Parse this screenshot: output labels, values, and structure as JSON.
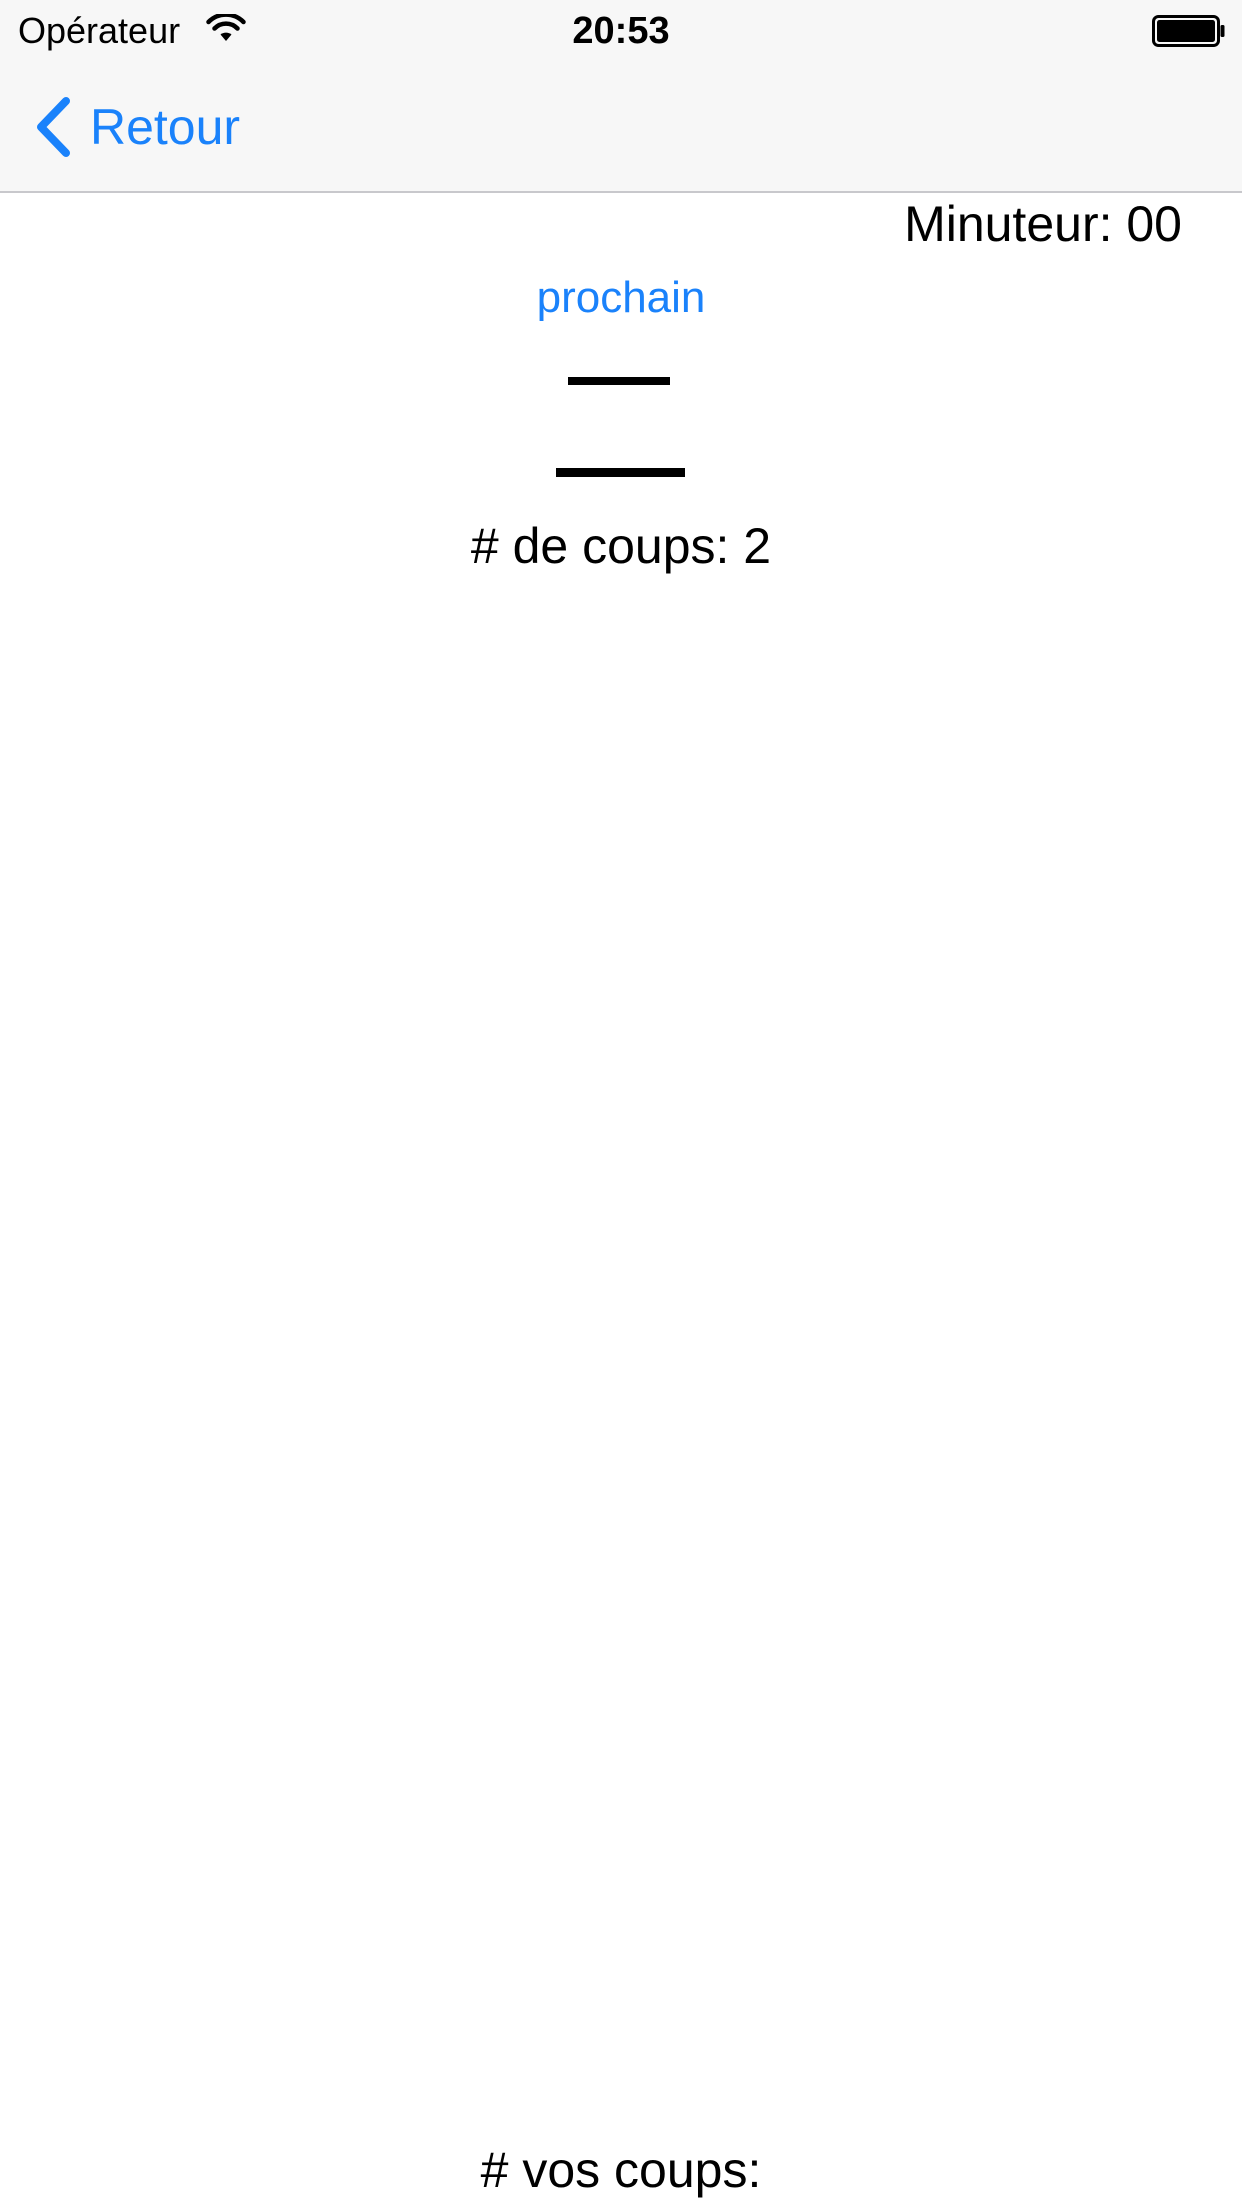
{
  "status_bar": {
    "carrier": "Opérateur",
    "time": "20:53",
    "wifi_icon": "wifi-icon",
    "battery_icon": "battery-icon"
  },
  "nav": {
    "back_label": "Retour",
    "back_icon": "chevron-left-icon",
    "accent_color": "#1a82fb"
  },
  "content": {
    "timer_text": "Minuteur: 00",
    "next_label": "prochain",
    "moves_text": "# de coups: 2",
    "your_moves_text": "# vos coups:"
  }
}
